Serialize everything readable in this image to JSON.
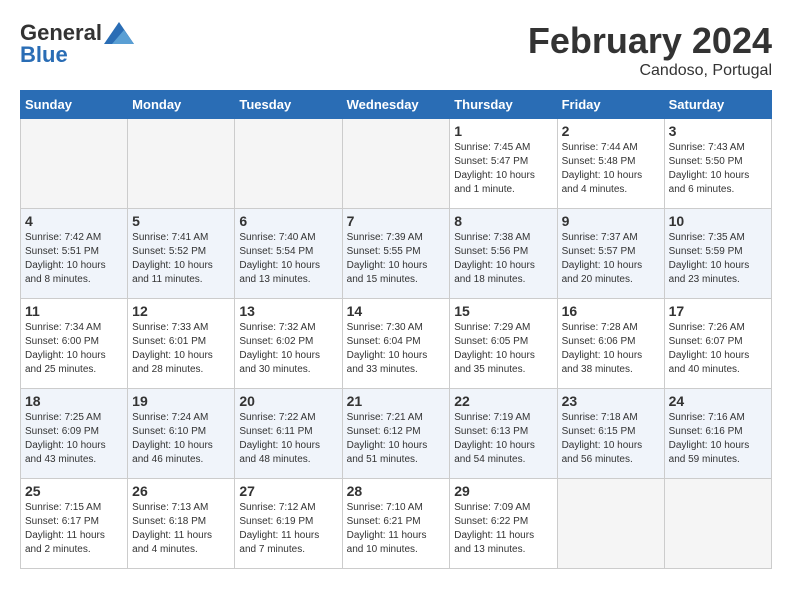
{
  "logo": {
    "general": "General",
    "blue": "Blue"
  },
  "title": {
    "month": "February 2024",
    "location": "Candoso, Portugal"
  },
  "headers": [
    "Sunday",
    "Monday",
    "Tuesday",
    "Wednesday",
    "Thursday",
    "Friday",
    "Saturday"
  ],
  "weeks": [
    [
      {
        "day": "",
        "info": ""
      },
      {
        "day": "",
        "info": ""
      },
      {
        "day": "",
        "info": ""
      },
      {
        "day": "",
        "info": ""
      },
      {
        "day": "1",
        "info": "Sunrise: 7:45 AM\nSunset: 5:47 PM\nDaylight: 10 hours\nand 1 minute."
      },
      {
        "day": "2",
        "info": "Sunrise: 7:44 AM\nSunset: 5:48 PM\nDaylight: 10 hours\nand 4 minutes."
      },
      {
        "day": "3",
        "info": "Sunrise: 7:43 AM\nSunset: 5:50 PM\nDaylight: 10 hours\nand 6 minutes."
      }
    ],
    [
      {
        "day": "4",
        "info": "Sunrise: 7:42 AM\nSunset: 5:51 PM\nDaylight: 10 hours\nand 8 minutes."
      },
      {
        "day": "5",
        "info": "Sunrise: 7:41 AM\nSunset: 5:52 PM\nDaylight: 10 hours\nand 11 minutes."
      },
      {
        "day": "6",
        "info": "Sunrise: 7:40 AM\nSunset: 5:54 PM\nDaylight: 10 hours\nand 13 minutes."
      },
      {
        "day": "7",
        "info": "Sunrise: 7:39 AM\nSunset: 5:55 PM\nDaylight: 10 hours\nand 15 minutes."
      },
      {
        "day": "8",
        "info": "Sunrise: 7:38 AM\nSunset: 5:56 PM\nDaylight: 10 hours\nand 18 minutes."
      },
      {
        "day": "9",
        "info": "Sunrise: 7:37 AM\nSunset: 5:57 PM\nDaylight: 10 hours\nand 20 minutes."
      },
      {
        "day": "10",
        "info": "Sunrise: 7:35 AM\nSunset: 5:59 PM\nDaylight: 10 hours\nand 23 minutes."
      }
    ],
    [
      {
        "day": "11",
        "info": "Sunrise: 7:34 AM\nSunset: 6:00 PM\nDaylight: 10 hours\nand 25 minutes."
      },
      {
        "day": "12",
        "info": "Sunrise: 7:33 AM\nSunset: 6:01 PM\nDaylight: 10 hours\nand 28 minutes."
      },
      {
        "day": "13",
        "info": "Sunrise: 7:32 AM\nSunset: 6:02 PM\nDaylight: 10 hours\nand 30 minutes."
      },
      {
        "day": "14",
        "info": "Sunrise: 7:30 AM\nSunset: 6:04 PM\nDaylight: 10 hours\nand 33 minutes."
      },
      {
        "day": "15",
        "info": "Sunrise: 7:29 AM\nSunset: 6:05 PM\nDaylight: 10 hours\nand 35 minutes."
      },
      {
        "day": "16",
        "info": "Sunrise: 7:28 AM\nSunset: 6:06 PM\nDaylight: 10 hours\nand 38 minutes."
      },
      {
        "day": "17",
        "info": "Sunrise: 7:26 AM\nSunset: 6:07 PM\nDaylight: 10 hours\nand 40 minutes."
      }
    ],
    [
      {
        "day": "18",
        "info": "Sunrise: 7:25 AM\nSunset: 6:09 PM\nDaylight: 10 hours\nand 43 minutes."
      },
      {
        "day": "19",
        "info": "Sunrise: 7:24 AM\nSunset: 6:10 PM\nDaylight: 10 hours\nand 46 minutes."
      },
      {
        "day": "20",
        "info": "Sunrise: 7:22 AM\nSunset: 6:11 PM\nDaylight: 10 hours\nand 48 minutes."
      },
      {
        "day": "21",
        "info": "Sunrise: 7:21 AM\nSunset: 6:12 PM\nDaylight: 10 hours\nand 51 minutes."
      },
      {
        "day": "22",
        "info": "Sunrise: 7:19 AM\nSunset: 6:13 PM\nDaylight: 10 hours\nand 54 minutes."
      },
      {
        "day": "23",
        "info": "Sunrise: 7:18 AM\nSunset: 6:15 PM\nDaylight: 10 hours\nand 56 minutes."
      },
      {
        "day": "24",
        "info": "Sunrise: 7:16 AM\nSunset: 6:16 PM\nDaylight: 10 hours\nand 59 minutes."
      }
    ],
    [
      {
        "day": "25",
        "info": "Sunrise: 7:15 AM\nSunset: 6:17 PM\nDaylight: 11 hours\nand 2 minutes."
      },
      {
        "day": "26",
        "info": "Sunrise: 7:13 AM\nSunset: 6:18 PM\nDaylight: 11 hours\nand 4 minutes."
      },
      {
        "day": "27",
        "info": "Sunrise: 7:12 AM\nSunset: 6:19 PM\nDaylight: 11 hours\nand 7 minutes."
      },
      {
        "day": "28",
        "info": "Sunrise: 7:10 AM\nSunset: 6:21 PM\nDaylight: 11 hours\nand 10 minutes."
      },
      {
        "day": "29",
        "info": "Sunrise: 7:09 AM\nSunset: 6:22 PM\nDaylight: 11 hours\nand 13 minutes."
      },
      {
        "day": "",
        "info": ""
      },
      {
        "day": "",
        "info": ""
      }
    ]
  ]
}
